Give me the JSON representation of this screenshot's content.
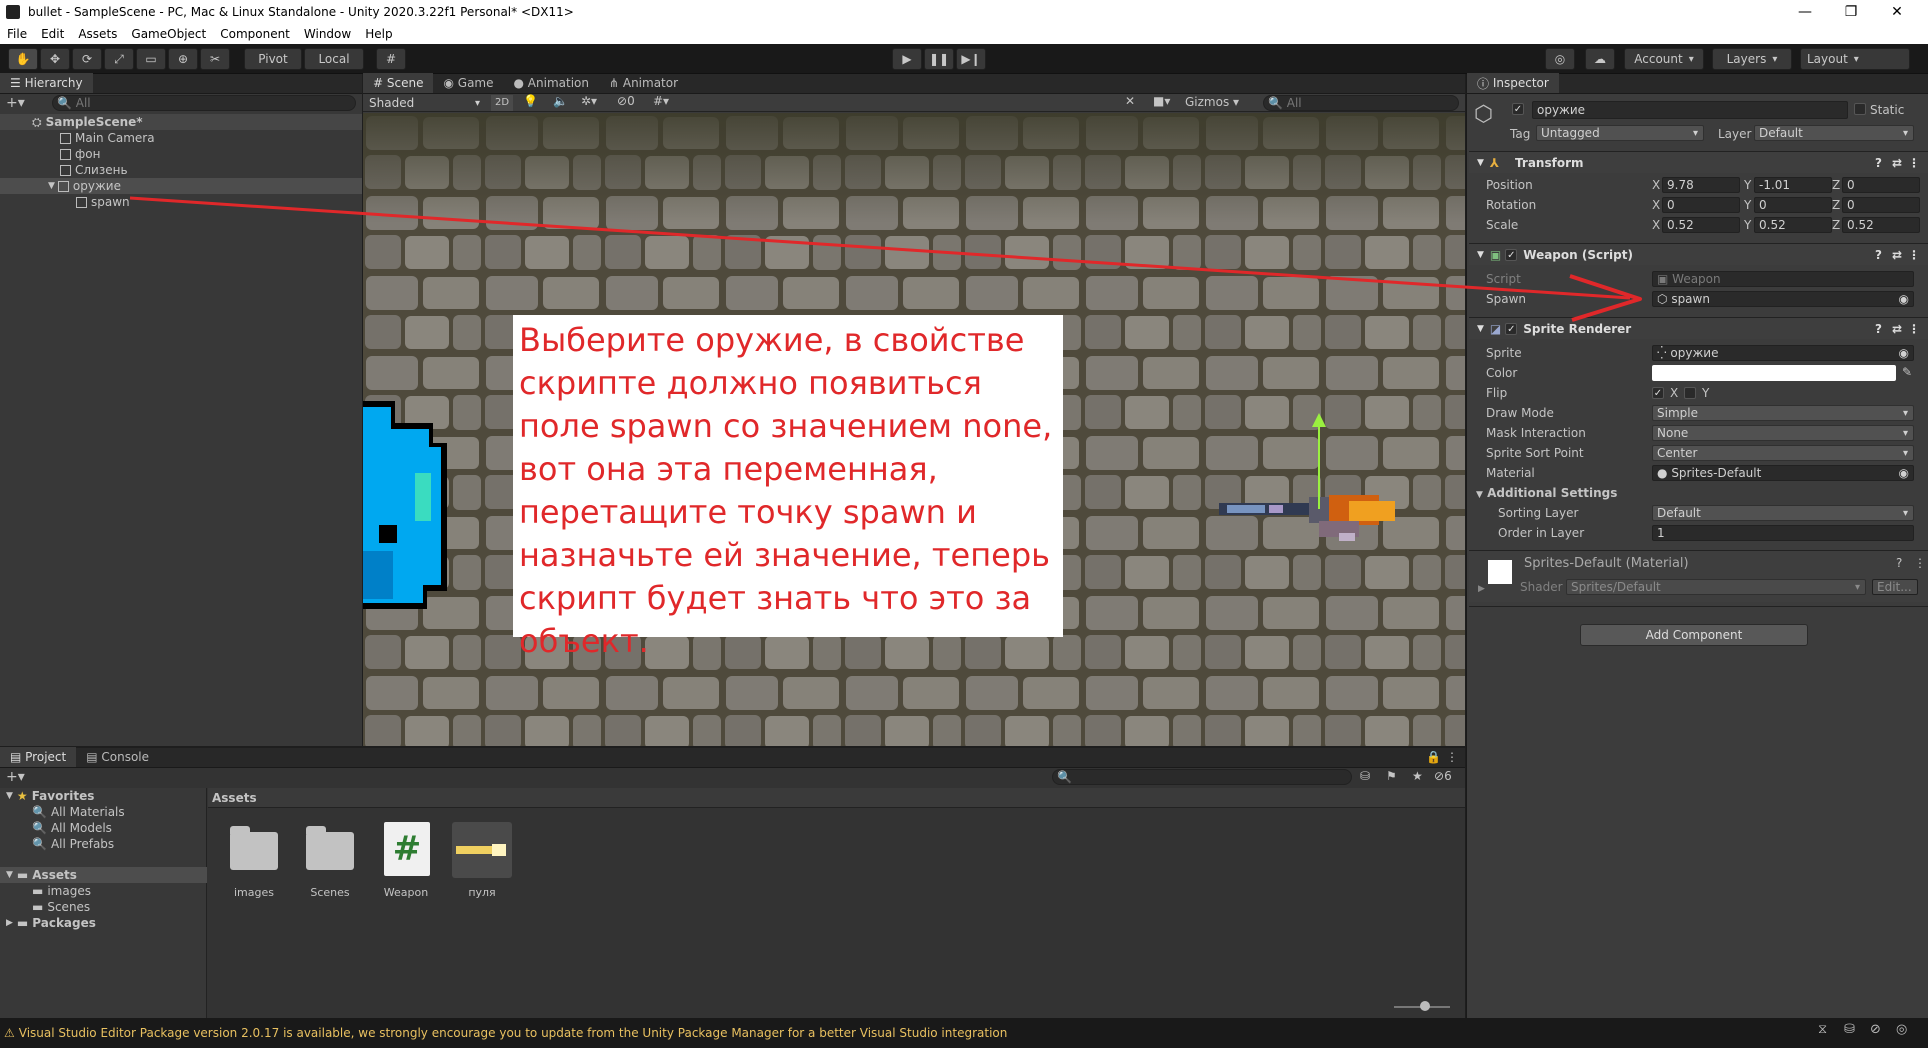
{
  "window": {
    "title": "bullet - SampleScene - PC, Mac & Linux Standalone - Unity 2020.3.22f1 Personal* <DX11>",
    "minimize_glyph": "—",
    "restore_glyph": "❐",
    "close_glyph": "✕"
  },
  "menu": [
    "File",
    "Edit",
    "Assets",
    "GameObject",
    "Component",
    "Window",
    "Help"
  ],
  "toolbar": {
    "pivot": "Pivot",
    "local": "Local",
    "account": "Account",
    "layers": "Layers",
    "layout": "Layout"
  },
  "hierarchy": {
    "tab": "Hierarchy",
    "search_placeholder": "All",
    "scene": "SampleScene*",
    "items": [
      "Main Camera",
      "фон",
      "Слизень",
      "оружие",
      "spawn"
    ]
  },
  "scene_view": {
    "tabs": [
      "Scene",
      "Game",
      "Animation",
      "Animator"
    ],
    "shading": "Shaded",
    "mode_2d": "2D",
    "hidden_count": "0",
    "gizmos": "Gizmos",
    "search_placeholder": "All",
    "annotation": "Выберите оружие, в свойстве скрипте должно появиться поле spawn со значением none, вот она эта переменная, перетащите точку spawn и назначьте ей значение, теперь скрипт будет знать что это за объект."
  },
  "inspector": {
    "tab": "Inspector",
    "object_name": "оружие",
    "static_label": "Static",
    "tag_label": "Tag",
    "tag_value": "Untagged",
    "layer_label": "Layer",
    "layer_value": "Default",
    "transform": {
      "title": "Transform",
      "position_label": "Position",
      "rotation_label": "Rotation",
      "scale_label": "Scale",
      "position": {
        "x": "9.78",
        "y": "-1.01",
        "z": "0"
      },
      "rotation": {
        "x": "0",
        "y": "0",
        "z": "0"
      },
      "scale": {
        "x": "0.52",
        "y": "0.52",
        "z": "0.52"
      }
    },
    "weapon_script": {
      "title": "Weapon (Script)",
      "script_label": "Script",
      "script_value": "Weapon",
      "spawn_label": "Spawn",
      "spawn_value": "spawn"
    },
    "sprite_renderer": {
      "title": "Sprite Renderer",
      "sprite_label": "Sprite",
      "sprite_value": "оружие",
      "color_label": "Color",
      "flip_label": "Flip",
      "flip_x": "X",
      "flip_y": "Y",
      "draw_mode_label": "Draw Mode",
      "draw_mode": "Simple",
      "mask_label": "Mask Interaction",
      "mask": "None",
      "sort_point_label": "Sprite Sort Point",
      "sort_point": "Center",
      "material_label": "Material",
      "material": "Sprites-Default",
      "additional": "Additional Settings",
      "sorting_layer_label": "Sorting Layer",
      "sorting_layer": "Default",
      "order_label": "Order in Layer",
      "order": "1"
    },
    "material": {
      "name": "Sprites-Default (Material)",
      "shader_label": "Shader",
      "shader": "Sprites/Default",
      "edit": "Edit..."
    },
    "add_component": "Add Component"
  },
  "project": {
    "tabs": [
      "Project",
      "Console"
    ],
    "favorites": "Favorites",
    "favorite_items": [
      "All Materials",
      "All Models",
      "All Prefabs"
    ],
    "assets_root": "Assets",
    "asset_folders": [
      "images",
      "Scenes"
    ],
    "packages": "Packages",
    "breadcrumb": "Assets",
    "hidden_count": "6",
    "assets": [
      "images",
      "Scenes",
      "Weapon",
      "пуля"
    ]
  },
  "status": {
    "message": "Visual Studio Editor Package version 2.0.17 is available, we strongly encourage you to update from the Unity Package Manager for a better Visual Studio integration"
  },
  "colors": {
    "arrow": "#e0282a",
    "annotation_text": "#e0282a",
    "slime": "#00a8f0"
  }
}
